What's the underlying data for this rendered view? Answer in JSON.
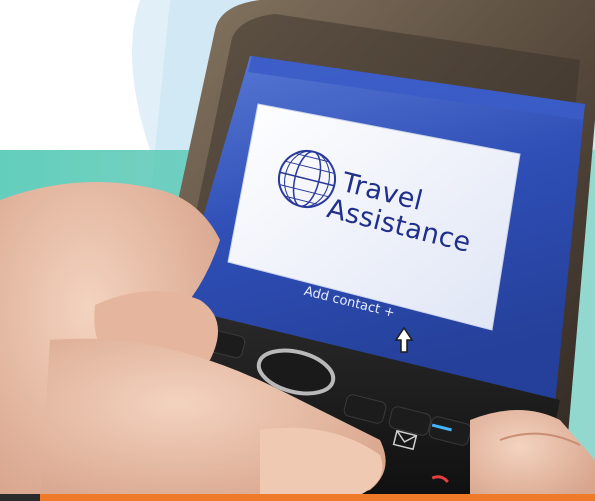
{
  "app_card": {
    "title_line1": "Travel",
    "title_line2": "Assistance",
    "icon": "globe-icon"
  },
  "screen": {
    "add_contact_label": "Add contact",
    "add_contact_glyph": "+",
    "cursor_icon": "pointer-cursor-icon"
  },
  "colors": {
    "teal_band": "#3cc3ad",
    "orange_strip": "#ef7a2a",
    "screen_blue": "#2d4fb5",
    "card_text": "#1f2f8a"
  }
}
